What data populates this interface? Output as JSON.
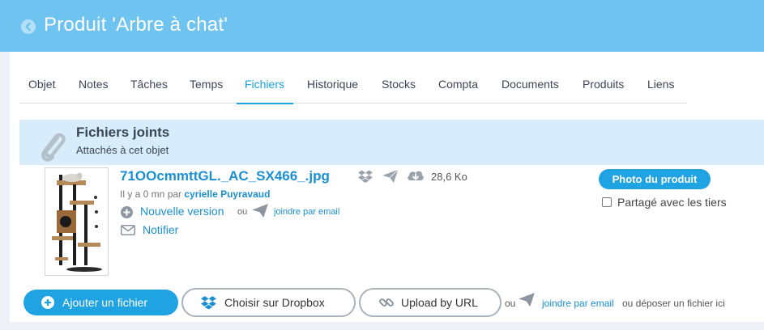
{
  "header": {
    "title": "Produit 'Arbre à chat'",
    "back_icon": "chevron-left-circle-icon"
  },
  "tabs": [
    {
      "label": "Objet"
    },
    {
      "label": "Notes"
    },
    {
      "label": "Tâches"
    },
    {
      "label": "Temps"
    },
    {
      "label": "Fichiers",
      "active": true
    },
    {
      "label": "Historique"
    },
    {
      "label": "Stocks"
    },
    {
      "label": "Compta"
    },
    {
      "label": "Documents"
    },
    {
      "label": "Produits"
    },
    {
      "label": "Liens"
    }
  ],
  "section": {
    "title": "Fichiers joints",
    "subtitle": "Attachés à cet objet",
    "icon": "paperclip-icon"
  },
  "file": {
    "name": "71OOcmmttGL._AC_SX466_.jpg",
    "size": "28,6 Ko",
    "uploaded_prefix": "Il y a 0 mn par",
    "uploaded_by": "cyrielle Puyravaud",
    "new_version_label": "Nouvelle version",
    "or_label": "ou",
    "join_by_email_label": "joindre par email",
    "notify_label": "Notifier",
    "badge_label": "Photo du produit",
    "share_label": "Partagé avec les tiers",
    "share_checked": false
  },
  "actions": {
    "add_file_label": "Ajouter un fichier",
    "dropbox_label": "Choisir sur Dropbox",
    "url_label": "Upload by URL",
    "or_label": "ou",
    "email_label": "joindre par email",
    "drop_label": "ou déposer un fichier ici"
  },
  "colors": {
    "header_bg": "#6ec3f0",
    "accent": "#1a8fd3",
    "section_bg": "#d7edfb",
    "button_primary": "#1fa3e3"
  }
}
